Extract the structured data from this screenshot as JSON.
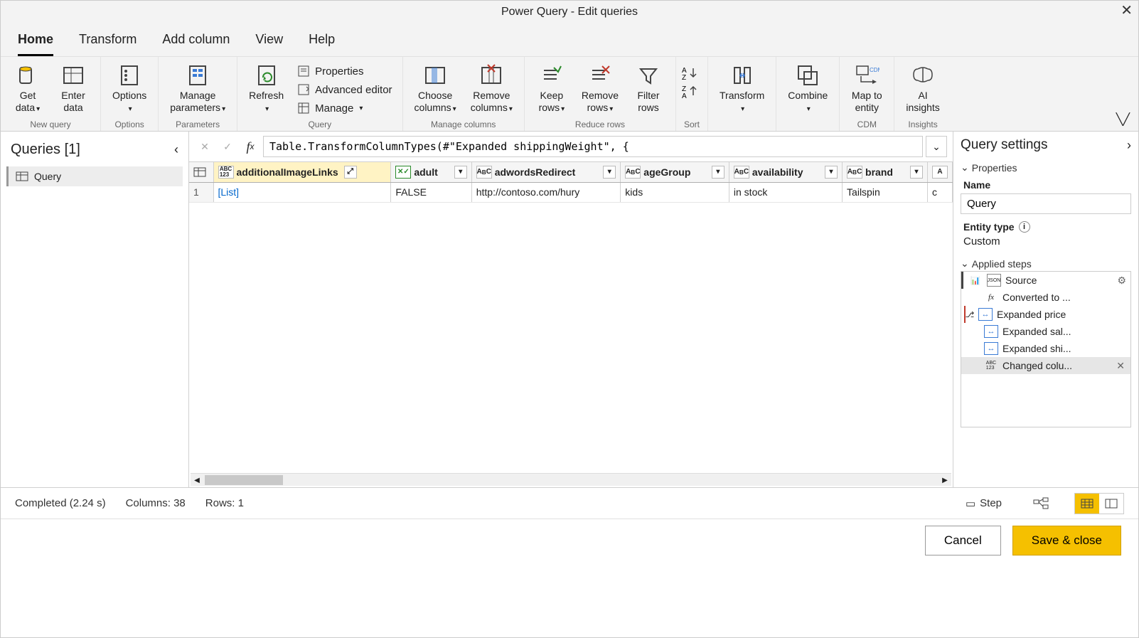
{
  "title": "Power Query - Edit queries",
  "tabs": [
    "Home",
    "Transform",
    "Add column",
    "View",
    "Help"
  ],
  "ribbon": {
    "get_data": "Get\ndata",
    "enter_data": "Enter\ndata",
    "options": "Options",
    "manage_parameters": "Manage\nparameters",
    "refresh": "Refresh",
    "properties": "Properties",
    "advanced_editor": "Advanced editor",
    "manage": "Manage",
    "choose_columns": "Choose\ncolumns",
    "remove_columns": "Remove\ncolumns",
    "keep_rows": "Keep\nrows",
    "remove_rows": "Remove\nrows",
    "filter_rows": "Filter\nrows",
    "transform": "Transform",
    "combine": "Combine",
    "map_to_entity": "Map to\nentity",
    "ai_insights": "AI\ninsights",
    "groups": {
      "new_query": "New query",
      "options": "Options",
      "parameters": "Parameters",
      "query": "Query",
      "manage_columns": "Manage columns",
      "reduce_rows": "Reduce rows",
      "sort": "Sort",
      "cdm": "CDM",
      "insights": "Insights"
    }
  },
  "left": {
    "title": "Queries [1]",
    "query_name": "Query"
  },
  "formula": "Table.TransformColumnTypes(#\"Expanded shippingWeight\", {",
  "columns": [
    {
      "name": "additionalImageLinks",
      "type": "abc123",
      "selected": true,
      "expandable": true
    },
    {
      "name": "adult",
      "type": "clean"
    },
    {
      "name": "adwordsRedirect",
      "type": "text"
    },
    {
      "name": "ageGroup",
      "type": "text"
    },
    {
      "name": "availability",
      "type": "text"
    },
    {
      "name": "brand",
      "type": "text"
    }
  ],
  "row": {
    "index": "1",
    "cells": [
      "[List]",
      "FALSE",
      "http://contoso.com/hury",
      "kids",
      "in stock",
      "Tailspin"
    ]
  },
  "right": {
    "title": "Query settings",
    "properties": "Properties",
    "name_label": "Name",
    "name_value": "Query",
    "entity_type": "Entity type",
    "entity_value": "Custom",
    "applied_steps": "Applied steps",
    "steps": [
      {
        "label": "Source",
        "gear": true,
        "icon": "json"
      },
      {
        "label": "Converted to ...",
        "icon": "fx"
      },
      {
        "label": "Expanded price",
        "icon": "expand",
        "branch": true
      },
      {
        "label": "Expanded sal...",
        "icon": "expand"
      },
      {
        "label": "Expanded shi...",
        "icon": "expand"
      },
      {
        "label": "Changed colu...",
        "icon": "abc123",
        "selected": true,
        "del": true
      }
    ]
  },
  "status": {
    "completed": "Completed (2.24 s)",
    "columns": "Columns: 38",
    "rows": "Rows: 1",
    "step": "Step"
  },
  "footer": {
    "cancel": "Cancel",
    "save": "Save & close"
  }
}
